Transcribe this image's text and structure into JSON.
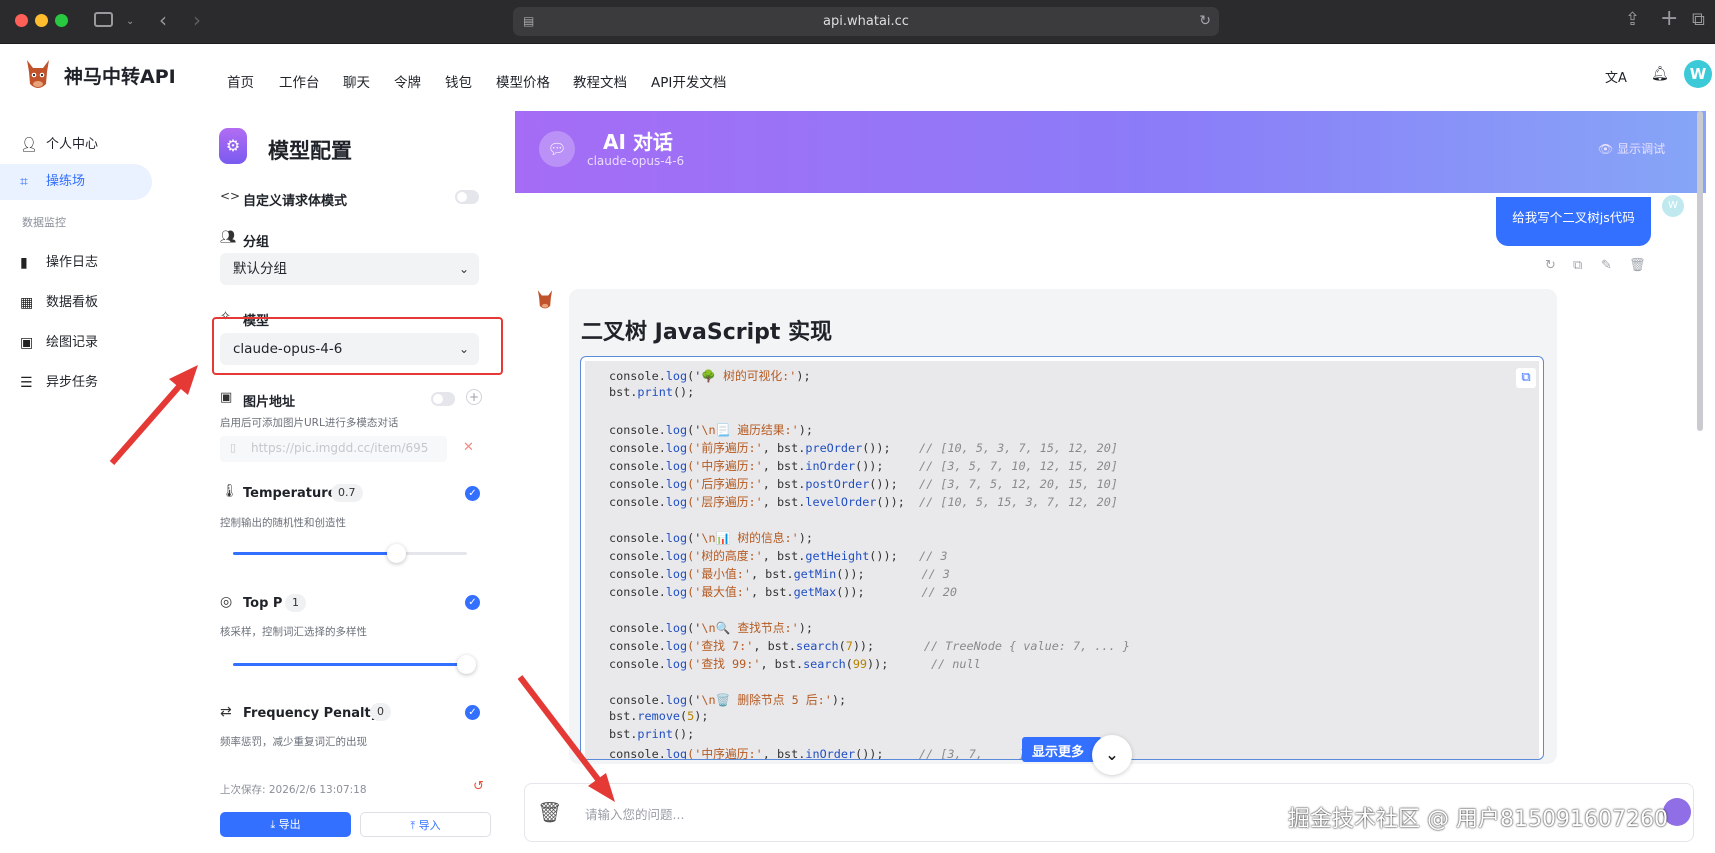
{
  "browser": {
    "url": "api.whatai.cc"
  },
  "header": {
    "brand": "神马中转API",
    "nav": [
      "首页",
      "工作台",
      "聊天",
      "令牌",
      "钱包",
      "模型价格",
      "教程文档",
      "API开发文档"
    ],
    "avatar_letter": "W"
  },
  "sidebar": {
    "items": [
      {
        "label": "个人中心",
        "icon": "person-icon",
        "active": false
      },
      {
        "label": "操练场",
        "icon": "playground-icon",
        "active": true
      }
    ],
    "section_label": "数据监控",
    "monitor_items": [
      {
        "label": "操作日志",
        "icon": "bar-chart-icon"
      },
      {
        "label": "数据看板",
        "icon": "dashboard-icon"
      },
      {
        "label": "绘图记录",
        "icon": "image-icon"
      },
      {
        "label": "异步任务",
        "icon": "task-list-icon"
      }
    ]
  },
  "config": {
    "title": "模型配置",
    "custom_body_label": "自定义请求体模式",
    "group_label": "分组",
    "group_value": "默认分组",
    "model_label": "模型",
    "model_value": "claude-opus-4-6",
    "image_label": "图片地址",
    "image_hint": "启用后可添加图片URL进行多模态对话",
    "image_placeholder": "https://pic.imgdd.cc/item/695",
    "temperature": {
      "label": "Temperature",
      "value": "0.7",
      "hint": "控制输出的随机性和创造性",
      "level": 0.7
    },
    "top_p": {
      "label": "Top P",
      "value": "1",
      "hint": "核采样，控制词汇选择的多样性",
      "level": 1.0
    },
    "frequency_penalty": {
      "label": "Frequency Penalty",
      "value": "0",
      "hint": "频率惩罚，减少重复词汇的出现"
    },
    "last_saved": "上次保存: 2026/2/6 13:07:18",
    "export_label": "导出",
    "import_label": "导入"
  },
  "chat": {
    "title": "AI 对话",
    "model": "claude-opus-4-6",
    "debug_label": "显示调试",
    "user_message": "给我写个二叉树js代码",
    "answer_title": "二叉树 JavaScript 实现",
    "show_more_label": "显示更多",
    "input_placeholder": "请输入您的问题..."
  },
  "code_lines": [
    [
      [
        "console.",
        "n"
      ],
      [
        "log",
        "f"
      ],
      [
        "('",
        "n"
      ],
      [
        "🌳 树的可视化:'",
        "s"
      ],
      [
        ");",
        "n"
      ]
    ],
    [
      [
        "bst.",
        "n"
      ],
      [
        "print",
        "f"
      ],
      [
        "();",
        "n"
      ]
    ],
    [],
    [
      [
        "console.",
        "n"
      ],
      [
        "log",
        "f"
      ],
      [
        "('",
        "n"
      ],
      [
        "\\n📃 遍历结果:'",
        "s"
      ],
      [
        ");",
        "n"
      ]
    ],
    [
      [
        "console.",
        "n"
      ],
      [
        "log",
        "f"
      ],
      [
        "('前序遍历:'",
        "s"
      ],
      [
        ", bst.",
        "n"
      ],
      [
        "preOrder",
        "f"
      ],
      [
        "());    ",
        "n"
      ],
      [
        "// [10, 5, 3, 7, 15, 12, 20]",
        "c"
      ]
    ],
    [
      [
        "console.",
        "n"
      ],
      [
        "log",
        "f"
      ],
      [
        "('中序遍历:'",
        "s"
      ],
      [
        ", bst.",
        "n"
      ],
      [
        "inOrder",
        "f"
      ],
      [
        "());     ",
        "n"
      ],
      [
        "// [3, 5, 7, 10, 12, 15, 20]",
        "c"
      ]
    ],
    [
      [
        "console.",
        "n"
      ],
      [
        "log",
        "f"
      ],
      [
        "('后序遍历:'",
        "s"
      ],
      [
        ", bst.",
        "n"
      ],
      [
        "postOrder",
        "f"
      ],
      [
        "());   ",
        "n"
      ],
      [
        "// [3, 7, 5, 12, 20, 15, 10]",
        "c"
      ]
    ],
    [
      [
        "console.",
        "n"
      ],
      [
        "log",
        "f"
      ],
      [
        "('层序遍历:'",
        "s"
      ],
      [
        ", bst.",
        "n"
      ],
      [
        "levelOrder",
        "f"
      ],
      [
        "());  ",
        "n"
      ],
      [
        "// [10, 5, 15, 3, 7, 12, 20]",
        "c"
      ]
    ],
    [],
    [
      [
        "console.",
        "n"
      ],
      [
        "log",
        "f"
      ],
      [
        "('",
        "n"
      ],
      [
        "\\n📊 树的信息:'",
        "s"
      ],
      [
        ");",
        "n"
      ]
    ],
    [
      [
        "console.",
        "n"
      ],
      [
        "log",
        "f"
      ],
      [
        "('树的高度:'",
        "s"
      ],
      [
        ", bst.",
        "n"
      ],
      [
        "getHeight",
        "f"
      ],
      [
        "());   ",
        "n"
      ],
      [
        "// 3",
        "c"
      ]
    ],
    [
      [
        "console.",
        "n"
      ],
      [
        "log",
        "f"
      ],
      [
        "('最小值:'",
        "s"
      ],
      [
        ", bst.",
        "n"
      ],
      [
        "getMin",
        "f"
      ],
      [
        "());        ",
        "n"
      ],
      [
        "// 3",
        "c"
      ]
    ],
    [
      [
        "console.",
        "n"
      ],
      [
        "log",
        "f"
      ],
      [
        "('最大值:'",
        "s"
      ],
      [
        ", bst.",
        "n"
      ],
      [
        "getMax",
        "f"
      ],
      [
        "());        ",
        "n"
      ],
      [
        "// 20",
        "c"
      ]
    ],
    [],
    [
      [
        "console.",
        "n"
      ],
      [
        "log",
        "f"
      ],
      [
        "('",
        "n"
      ],
      [
        "\\n🔍 查找节点:'",
        "s"
      ],
      [
        ");",
        "n"
      ]
    ],
    [
      [
        "console.",
        "n"
      ],
      [
        "log",
        "f"
      ],
      [
        "('查找 7:'",
        "s"
      ],
      [
        ", bst.",
        "n"
      ],
      [
        "search",
        "f"
      ],
      [
        "(",
        "n"
      ],
      [
        "7",
        "m"
      ],
      [
        "));       ",
        "n"
      ],
      [
        "// TreeNode { value: 7, ... }",
        "c"
      ]
    ],
    [
      [
        "console.",
        "n"
      ],
      [
        "log",
        "f"
      ],
      [
        "('查找 99:'",
        "s"
      ],
      [
        ", bst.",
        "n"
      ],
      [
        "search",
        "f"
      ],
      [
        "(",
        "n"
      ],
      [
        "99",
        "m"
      ],
      [
        "));      ",
        "n"
      ],
      [
        "// null",
        "c"
      ]
    ],
    [],
    [
      [
        "console.",
        "n"
      ],
      [
        "log",
        "f"
      ],
      [
        "('",
        "n"
      ],
      [
        "\\n🗑️ 删除节点 5 后:'",
        "s"
      ],
      [
        ");",
        "n"
      ]
    ],
    [
      [
        "bst.",
        "n"
      ],
      [
        "remove",
        "f"
      ],
      [
        "(",
        "n"
      ],
      [
        "5",
        "m"
      ],
      [
        ");",
        "n"
      ]
    ],
    [
      [
        "bst.",
        "n"
      ],
      [
        "print",
        "f"
      ],
      [
        "();",
        "n"
      ]
    ],
    [
      [
        "console.",
        "n"
      ],
      [
        "log",
        "f"
      ],
      [
        "('中序遍历:'",
        "s"
      ],
      [
        ", bst.",
        "n"
      ],
      [
        "inOrder",
        "f"
      ],
      [
        "());     ",
        "n"
      ],
      [
        "// [3, 7, ",
        "c"
      ],
      [
        "    ",
        "n"
      ],
      [
        "]",
        "c"
      ]
    ]
  ],
  "watermark": "掘金技术社区 @ 用户815091607260",
  "accent_color": "#3370ff",
  "highlight_color": "#e53935"
}
